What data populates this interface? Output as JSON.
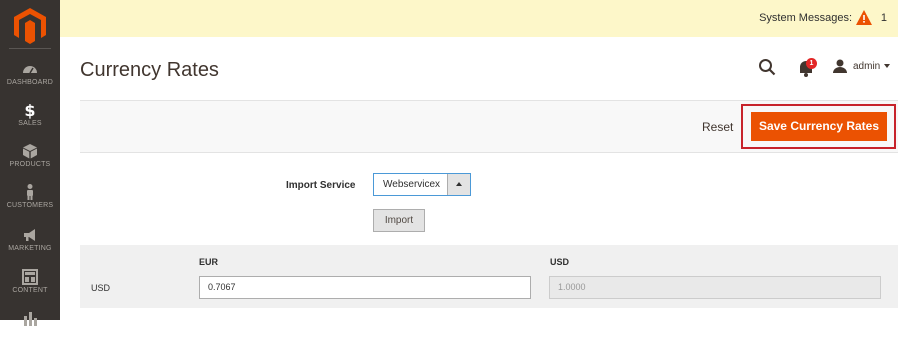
{
  "sidebar": {
    "items": [
      {
        "label": "DASHBOARD",
        "icon": "dashboard-icon"
      },
      {
        "label": "SALES",
        "icon": "dollar-icon"
      },
      {
        "label": "PRODUCTS",
        "icon": "cube-icon"
      },
      {
        "label": "CUSTOMERS",
        "icon": "person-icon"
      },
      {
        "label": "MARKETING",
        "icon": "megaphone-icon"
      },
      {
        "label": "CONTENT",
        "icon": "layout-icon"
      },
      {
        "label": "",
        "icon": "bar-chart-icon"
      }
    ]
  },
  "system_messages": {
    "label": "System Messages:",
    "count": "1",
    "icon": "warning-icon"
  },
  "header": {
    "title": "Currency Rates",
    "notifications_count": "1",
    "user": "admin"
  },
  "actions": {
    "reset_label": "Reset",
    "save_label": "Save Currency Rates"
  },
  "import": {
    "label": "Import Service",
    "service_value": "Webservicex",
    "button_label": "Import"
  },
  "rates": {
    "columns": [
      "EUR",
      "USD"
    ],
    "rows": [
      {
        "currency": "USD",
        "values": [
          "0.7067",
          "1.0000"
        ]
      }
    ]
  },
  "colors": {
    "sidebar": "#373330",
    "accent": "#eb5202",
    "highlight": "#c7232b",
    "system_bar": "#fdf7c9"
  }
}
